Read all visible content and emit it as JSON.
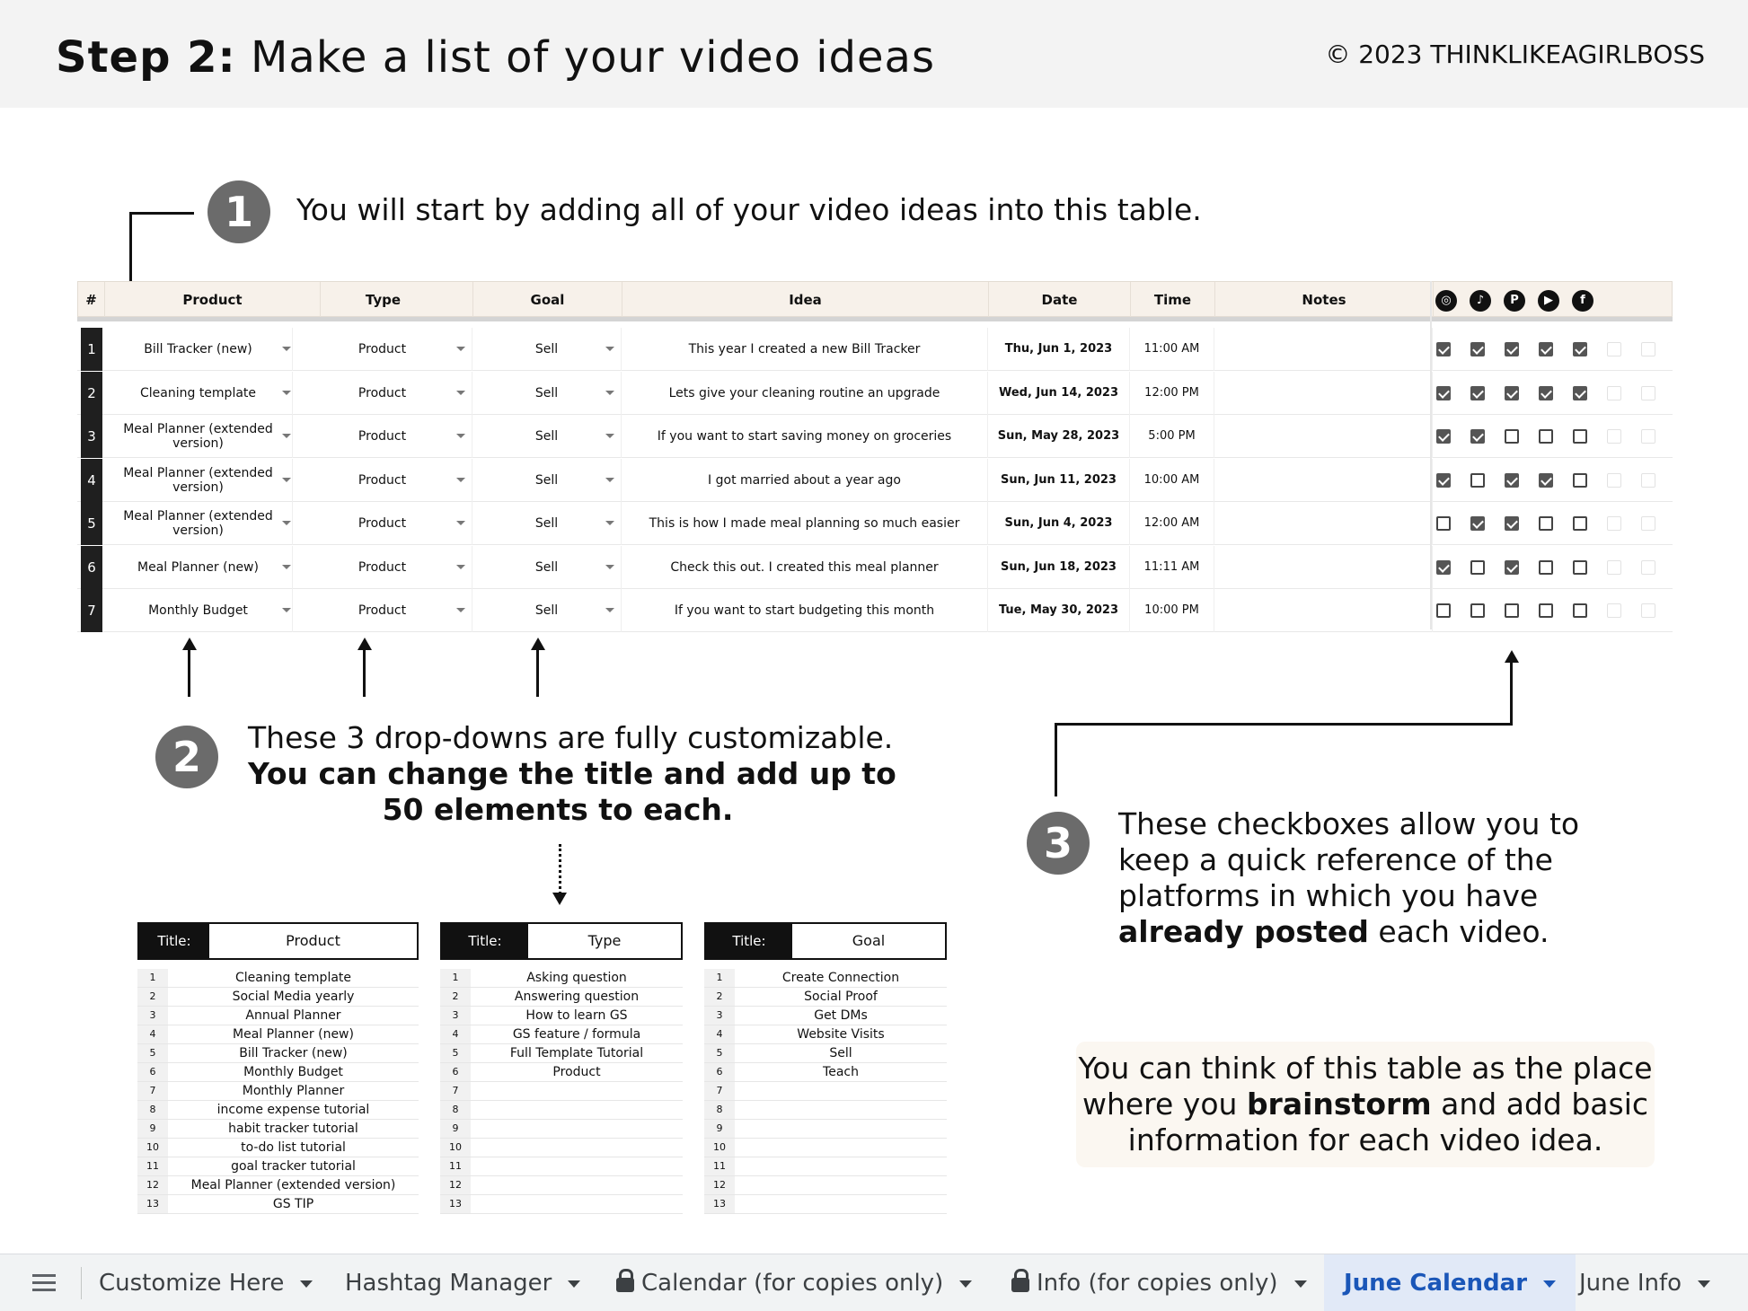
{
  "header": {
    "step_bold": "Step 2:",
    "step_rest": "Make a list of your video ideas",
    "copyright": "©  2023 THINKLIKEAGIRLBOSS"
  },
  "step1": {
    "num": "1",
    "text": "You will start by adding all of your video ideas into this table."
  },
  "step2": {
    "num": "2",
    "line1": "These 3 drop-downs are fully customizable.",
    "line2": "You can change the title and add up to",
    "line3": "50 elements to each."
  },
  "step3": {
    "num": "3",
    "line1": "These checkboxes allow you to",
    "line2": "keep a quick reference of the",
    "line3": "platforms in which you have",
    "line4_bold": "already posted",
    "line4_rest": " each video."
  },
  "note": {
    "line1": "You can think of this table as the place",
    "line2_pre": "where you ",
    "line2_bold": "brainstorm",
    "line2_post": " and add basic",
    "line3": "information for each video idea."
  },
  "main_table": {
    "headers": {
      "num": "#",
      "product": "Product",
      "type": "Type",
      "goal": "Goal",
      "idea": "Idea",
      "date": "Date",
      "time": "Time",
      "notes": "Notes"
    },
    "platforms": [
      "instagram-icon",
      "tiktok-icon",
      "pinterest-icon",
      "youtube-icon",
      "facebook-icon"
    ],
    "rows": [
      {
        "n": "1",
        "product": "Bill Tracker (new)",
        "type": "Product",
        "goal": "Sell",
        "idea": "This year I created a new Bill Tracker",
        "date": "Thu, Jun 1, 2023",
        "time": "11:00 AM",
        "checks": [
          true,
          true,
          true,
          true,
          true
        ]
      },
      {
        "n": "2",
        "product": "Cleaning template",
        "type": "Product",
        "goal": "Sell",
        "idea": "Lets give your cleaning routine an upgrade",
        "date": "Wed, Jun 14, 2023",
        "time": "12:00 PM",
        "checks": [
          true,
          true,
          true,
          true,
          true
        ]
      },
      {
        "n": "3",
        "product": "Meal Planner (extended version)",
        "type": "Product",
        "goal": "Sell",
        "idea": "If you want to start saving money on groceries",
        "date": "Sun, May 28, 2023",
        "time": "5:00 PM",
        "checks": [
          true,
          true,
          false,
          false,
          false
        ]
      },
      {
        "n": "4",
        "product": "Meal Planner (extended version)",
        "type": "Product",
        "goal": "Sell",
        "idea": "I got married about a year ago",
        "date": "Sun, Jun 11, 2023",
        "time": "10:00 AM",
        "checks": [
          true,
          false,
          true,
          true,
          false
        ]
      },
      {
        "n": "5",
        "product": "Meal Planner (extended version)",
        "type": "Product",
        "goal": "Sell",
        "idea": "This is how I made meal planning so much easier",
        "date": "Sun, Jun 4, 2023",
        "time": "12:00 AM",
        "checks": [
          false,
          true,
          true,
          false,
          false
        ]
      },
      {
        "n": "6",
        "product": "Meal Planner (new)",
        "type": "Product",
        "goal": "Sell",
        "idea": "Check this out. I created this meal planner",
        "date": "Sun, Jun 18, 2023",
        "time": "11:11 AM",
        "checks": [
          true,
          false,
          true,
          false,
          false
        ]
      },
      {
        "n": "7",
        "product": "Monthly Budget",
        "type": "Product",
        "goal": "Sell",
        "idea": "If you want to start budgeting this month",
        "date": "Tue, May 30, 2023",
        "time": "10:00 PM",
        "checks": [
          false,
          false,
          false,
          false,
          false
        ]
      }
    ]
  },
  "option_tables": [
    {
      "title_label": "Title:",
      "title_value": "Product",
      "items": [
        "Cleaning template",
        "Social Media yearly",
        "Annual Planner",
        "Meal Planner (new)",
        "Bill Tracker (new)",
        "Monthly Budget",
        "Monthly Planner",
        "income expense tutorial",
        "habit tracker tutorial",
        "to-do list tutorial",
        "goal tracker tutorial",
        "Meal Planner (extended version)",
        "GS TIP"
      ]
    },
    {
      "title_label": "Title:",
      "title_value": "Type",
      "items": [
        "Asking question",
        "Answering question",
        "How to learn GS",
        "GS feature / formula",
        "Full Template Tutorial",
        "Product",
        "",
        "",
        "",
        "",
        "",
        "",
        ""
      ]
    },
    {
      "title_label": "Title:",
      "title_value": "Goal",
      "items": [
        "Create Connection",
        "Social Proof",
        "Get DMs",
        "Website Visits",
        "Sell",
        "Teach",
        "",
        "",
        "",
        "",
        "",
        "",
        ""
      ]
    }
  ],
  "row_numbers": [
    "1",
    "2",
    "3",
    "4",
    "5",
    "6",
    "7",
    "8",
    "9",
    "10",
    "11",
    "12",
    "13"
  ],
  "tabs": [
    {
      "label": "Customize Here",
      "locked": false,
      "active": false
    },
    {
      "label": "Hashtag Manager",
      "locked": false,
      "active": false
    },
    {
      "label": "Calendar (for copies only)",
      "locked": true,
      "active": false
    },
    {
      "label": "Info (for copies only)",
      "locked": true,
      "active": false
    },
    {
      "label": "June Calendar",
      "locked": false,
      "active": true
    },
    {
      "label": "June Info",
      "locked": false,
      "active": false
    }
  ],
  "colors": {
    "badge": "#6b6b6b",
    "header_bg": "#f3f3f3",
    "table_head": "#f7f1ea",
    "active_tab": "#1a56b8"
  }
}
